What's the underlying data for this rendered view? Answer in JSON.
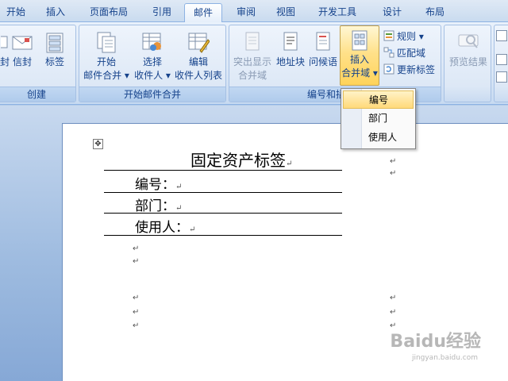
{
  "tabs": [
    "开始",
    "插入",
    "页面布局",
    "引用",
    "邮件",
    "审阅",
    "视图",
    "开发工具",
    "设计",
    "布局"
  ],
  "active_tab": "邮件",
  "ribbon": {
    "create_group": {
      "label": "创建",
      "buttons": [
        "封",
        "信封",
        "标签"
      ]
    },
    "start_merge_group": {
      "label": "开始邮件合并",
      "start_merge": [
        "开始",
        "邮件合并 ▾"
      ],
      "select_recipients": [
        "选择",
        "收件人 ▾"
      ],
      "edit_recipients": [
        "编辑",
        "收件人列表"
      ]
    },
    "write_insert_group": {
      "label": "编号和插",
      "highlight_fields": [
        "突出显示",
        "合并域"
      ],
      "address_block": "地址块",
      "greeting_line": "问候语",
      "insert_merge_field": [
        "插入",
        "合并域 ▾"
      ],
      "rules": "规则 ▾",
      "match_fields": "匹配域",
      "update_labels": "更新标签"
    },
    "preview_group": {
      "preview_results": "预览结果"
    }
  },
  "dropdown": {
    "items": [
      "编号",
      "部门",
      "使用人"
    ],
    "highlighted": "编号"
  },
  "document": {
    "title": "固定资产标签",
    "fields": [
      "编号：",
      "部门：",
      "使用人："
    ],
    "paragraph_mark": "↵"
  },
  "watermark": {
    "brand": "Baidu经验",
    "url": "jingyan.baidu.com"
  },
  "colors": {
    "ribbon_text": "#15428b",
    "highlight": "#ffd35a"
  }
}
